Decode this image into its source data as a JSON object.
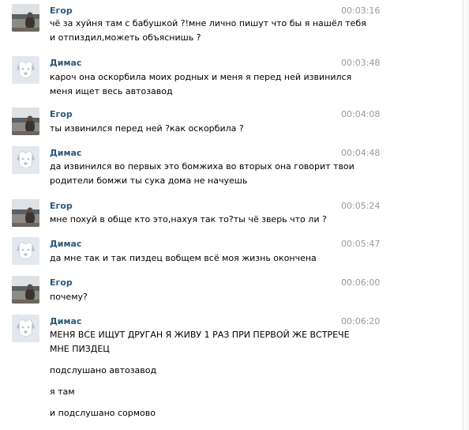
{
  "messages": [
    {
      "author": "Егор",
      "time": "00:03:16",
      "avatar_icon": "user-photo-icon",
      "lines": [
        "чё за хуйня там с бабушкой ?!мне лично пишут что бы я нашёл тебя",
        "и отпиздил,можеть объяснишь ?"
      ]
    },
    {
      "author": "Димас",
      "time": "00:03:48",
      "avatar_icon": "default-dog-avatar-icon",
      "lines": [
        "кароч она оскорбила моих родных и меня я перед ней извинился",
        "меня ищет весь автозавод"
      ]
    },
    {
      "author": "Егор",
      "time": "00:04:08",
      "avatar_icon": "user-photo-icon",
      "lines": [
        "ты извинился перед ней ?как оскорбила ?"
      ]
    },
    {
      "author": "Димас",
      "time": "00:04:48",
      "avatar_icon": "default-dog-avatar-icon",
      "lines": [
        "да извинился во первых это бомжиха во вторых она говорит твои",
        "родители бомжи ты сука дома не начуешь"
      ]
    },
    {
      "author": "Егор",
      "time": "00:05:24",
      "avatar_icon": "user-photo-icon",
      "lines": [
        "мне похуй в обще кто это,нахуя так то?ты чё зверь что ли ?"
      ]
    },
    {
      "author": "Димас",
      "time": "00:05:47",
      "avatar_icon": "default-dog-avatar-icon",
      "lines": [
        "да мне так и так пиздец вобщем всё моя жизнь окончена"
      ]
    },
    {
      "author": "Егор",
      "time": "00:06:00",
      "avatar_icon": "user-photo-icon",
      "lines": [
        "почему?"
      ]
    },
    {
      "author": "Димас",
      "time": "00:06:20",
      "avatar_icon": "default-dog-avatar-icon",
      "lines": [
        "МЕНЯ ВСЕ ИЩУТ ДРУГАН Я ЖИВУ 1 РАЗ ПРИ ПЕРВОЙ ЖЕ ВСТРЕЧЕ",
        "МНЕ ПИЗДЕЦ",
        "подслушано автозавод",
        "я там",
        "и подслушано сормово"
      ]
    }
  ],
  "colors": {
    "author": "#2b587a",
    "time": "#999999",
    "text": "#000000"
  }
}
